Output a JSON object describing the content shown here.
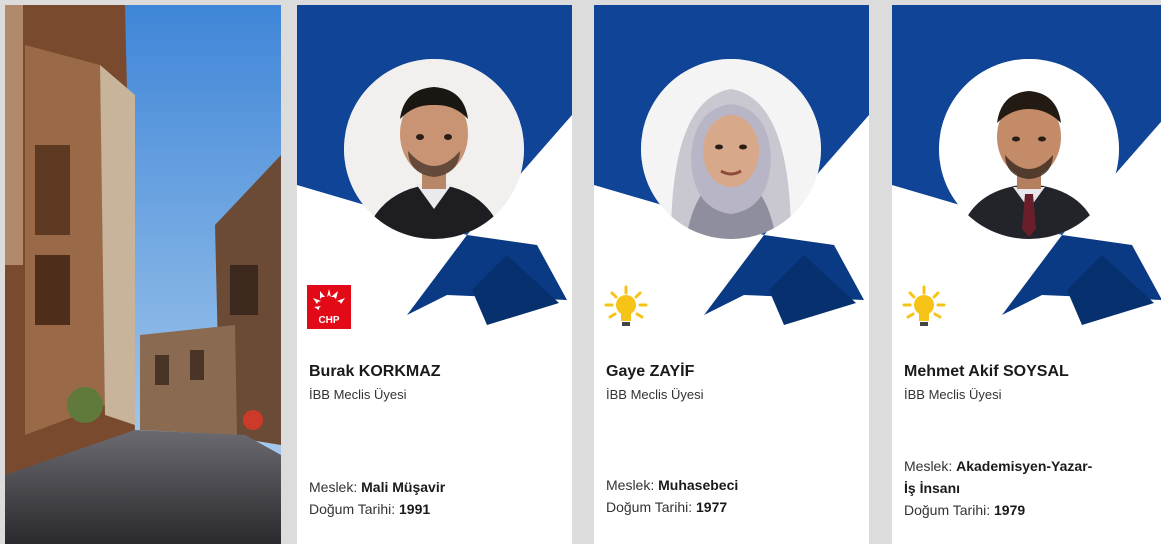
{
  "colors": {
    "banner_blue": "#0f4497",
    "banner_dark": "#07306f",
    "chp_red": "#e30a17",
    "akp_yellow": "#f6c416"
  },
  "profiles": [
    {
      "name": "Burak KORKMAZ",
      "role": "İBB Meclis Üyesi",
      "job_label": "Meslek: ",
      "job": "Mali Müşavir",
      "birth_label": "Doğum Tarihi: ",
      "birth": "1991",
      "party_logo": "chp-logo",
      "logo_text": "CHP"
    },
    {
      "name": "Gaye ZAYİF",
      "role": "İBB Meclis Üyesi",
      "job_label": "Meslek: ",
      "job": "Muhasebeci",
      "birth_label": "Doğum Tarihi: ",
      "birth": "1977",
      "party_logo": "ak-parti-bulb-logo"
    },
    {
      "name": "Mehmet Akif SOYSAL",
      "role": "İBB Meclis Üyesi",
      "job_label": "Meslek: ",
      "job_line1": "Akademisyen-Yazar-",
      "job_line2": "İş İnsanı",
      "birth_label": "Doğum Tarihi: ",
      "birth": "1979",
      "party_logo": "ak-parti-bulb-logo"
    }
  ]
}
